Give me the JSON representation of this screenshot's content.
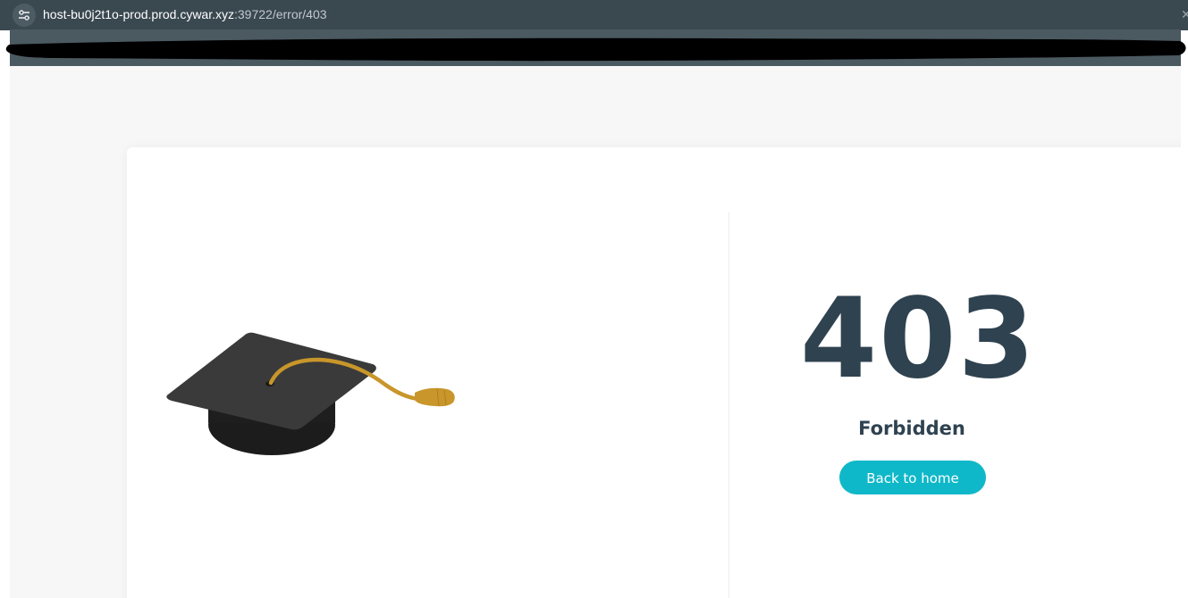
{
  "browser": {
    "url_host": "host-bu0j2t1o-prod.prod.cywar.xyz",
    "url_path": ":39722/error/403",
    "close_glyph": "✕",
    "site_info_icon": "tune-icon"
  },
  "redaction": {
    "color": "#000000"
  },
  "error": {
    "code": "403",
    "title": "Forbidden",
    "button_label": "Back to home"
  },
  "illustration": {
    "icon": "graduation-cap-icon",
    "cap_color": "#3a3a3a",
    "tassel_color": "#c8962a"
  },
  "colors": {
    "text_dark": "#2f4250",
    "accent": "#0fb8c9",
    "page_background": "#f7f7f7",
    "browser_chrome": "#3a4850"
  }
}
